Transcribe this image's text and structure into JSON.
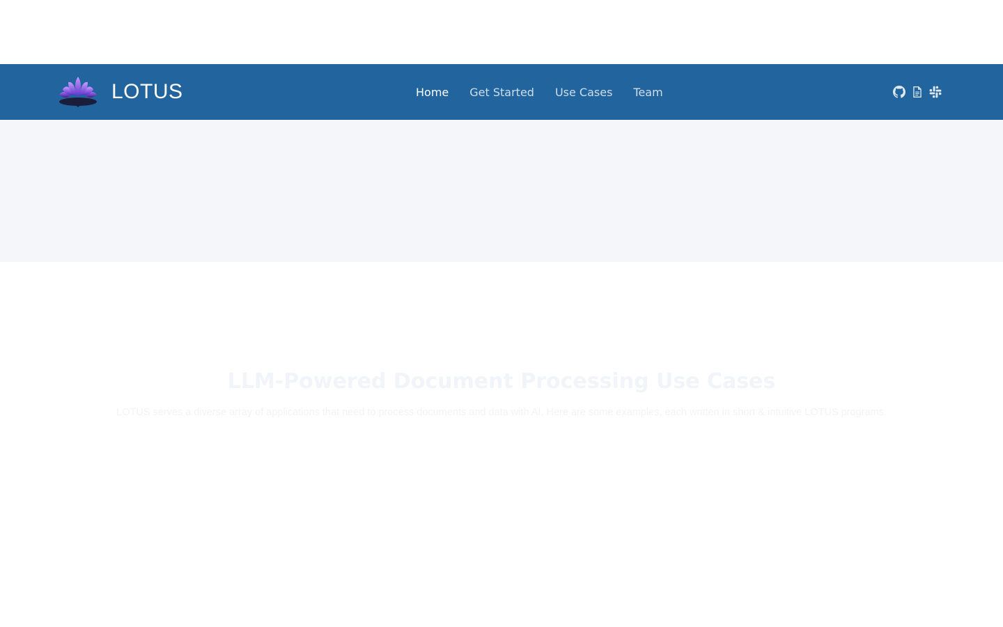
{
  "brand": {
    "name": "LOTUS",
    "logo_icon": "lotus-flower-icon"
  },
  "nav": {
    "links": [
      {
        "label": "Home",
        "active": true
      },
      {
        "label": "Get Started",
        "active": false
      },
      {
        "label": "Use Cases",
        "active": false
      },
      {
        "label": "Team",
        "active": false
      }
    ],
    "icons": [
      "github-icon",
      "document-icon",
      "slack-icon"
    ]
  },
  "use_cases": {
    "title": "LLM-Powered Document Processing Use Cases",
    "subtitle": "LOTUS serves a diverse array of applications that need to process documents and data with AI. Here are some examples, each written in short & intuitive LOTUS programs."
  },
  "colors": {
    "navbar_bg": "#22649e",
    "hero_bg": "#f4f6fa",
    "nav_text": "#ffffff"
  }
}
